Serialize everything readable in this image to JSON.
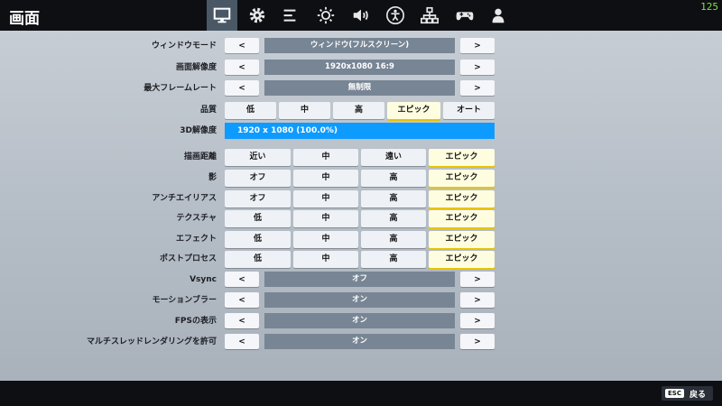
{
  "page": {
    "title": "画面",
    "fps": "125"
  },
  "tabs": [
    {
      "icon": "monitor-icon",
      "active": true
    },
    {
      "icon": "gear-icon"
    },
    {
      "icon": "list-icon"
    },
    {
      "icon": "brightness-icon"
    },
    {
      "icon": "speaker-icon"
    },
    {
      "icon": "accessibility-icon"
    },
    {
      "icon": "network-icon"
    },
    {
      "icon": "controller-icon"
    },
    {
      "icon": "user-icon"
    }
  ],
  "arrow_left": "<",
  "arrow_right": ">",
  "window_mode": {
    "label": "ウィンドウモード",
    "value": "ウィンドウ(フルスクリーン)"
  },
  "resolution": {
    "label": "画面解像度",
    "value": "1920x1080 16:9"
  },
  "frame_rate": {
    "label": "最大フレームレート",
    "value": "無制限"
  },
  "quality": {
    "label": "品質",
    "options": [
      "低",
      "中",
      "高",
      "エピック",
      "オート"
    ],
    "selected": "エピック"
  },
  "res3d": {
    "label": "3D解像度",
    "value": "1920 x 1080 (100.0%)",
    "fill_percent": 100
  },
  "view_distance": {
    "label": "描画距離",
    "options": [
      "近い",
      "中",
      "遠い",
      "エピック"
    ],
    "selected": "エピック"
  },
  "shadows": {
    "label": "影",
    "options": [
      "オフ",
      "中",
      "高",
      "エピック"
    ],
    "selected": "エピック"
  },
  "anti_aliasing": {
    "label": "アンチエイリアス",
    "options": [
      "オフ",
      "中",
      "高",
      "エピック"
    ],
    "selected": "エピック"
  },
  "textures": {
    "label": "テクスチャ",
    "options": [
      "低",
      "中",
      "高",
      "エピック"
    ],
    "selected": "エピック"
  },
  "effects": {
    "label": "エフェクト",
    "options": [
      "低",
      "中",
      "高",
      "エピック"
    ],
    "selected": "エピック"
  },
  "post_process": {
    "label": "ポストプロセス",
    "options": [
      "低",
      "中",
      "高",
      "エピック"
    ],
    "selected": "エピック"
  },
  "vsync": {
    "label": "Vsync",
    "value": "オフ"
  },
  "motion_blur": {
    "label": "モーションブラー",
    "value": "オン"
  },
  "show_fps": {
    "label": "FPSの表示",
    "value": "オン"
  },
  "multithread": {
    "label": "マルチスレッドレンダリングを許可",
    "value": "オン"
  },
  "footer": {
    "esc_key": "ESC",
    "back_label": "戻る"
  },
  "colors": {
    "topbar": "#0d0f13",
    "active_tab": "#4a5866",
    "value_bg": "#778594",
    "selected_option": "#fffde0",
    "selected_underline": "#e8c400",
    "res3d_bar": "#0e9bff",
    "fps_text": "#7ee23c"
  }
}
